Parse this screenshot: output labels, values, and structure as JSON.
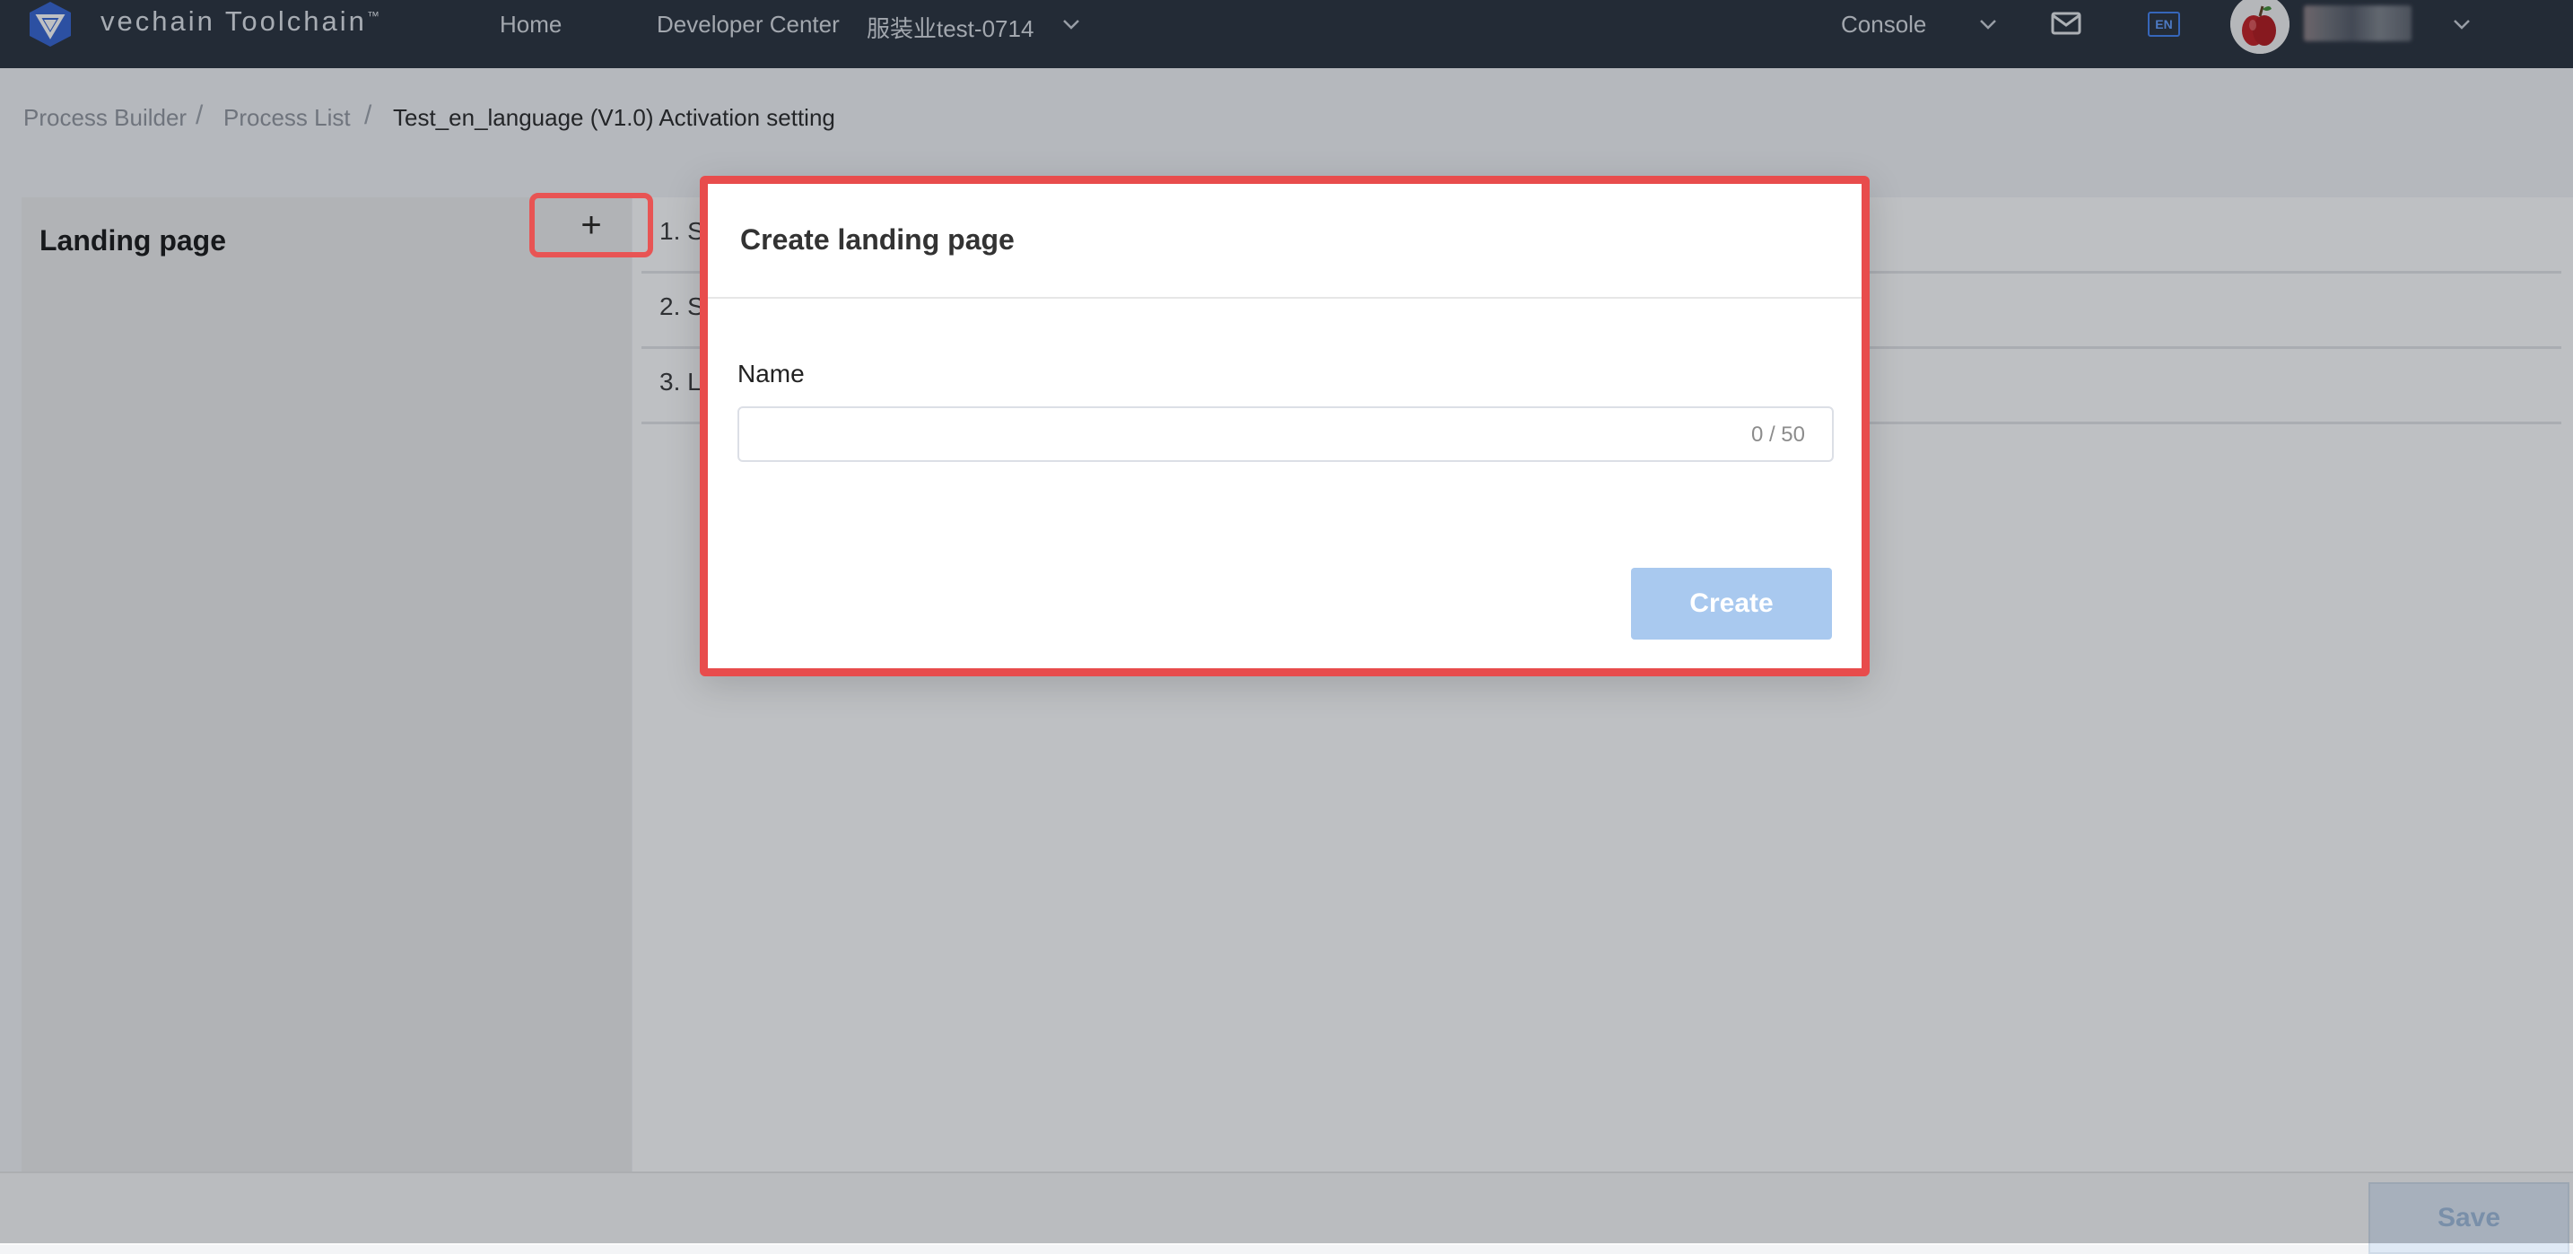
{
  "topnav": {
    "brand": "vechain Toolchain",
    "trademark": "™",
    "home": "Home",
    "developer_center": "Developer Center",
    "org": "服装业test-0714",
    "console": "Console",
    "lang_badge": "EN",
    "icons": {
      "logo": "vechain-logo-icon",
      "org_dropdown": "chevron-down-icon",
      "console_dropdown": "chevron-down-icon",
      "mail": "mail-icon",
      "language": "language-icon",
      "avatar": "avatar-apple-icon",
      "user_dropdown": "chevron-down-icon"
    }
  },
  "breadcrumb": {
    "items": [
      "Process Builder",
      "Process List",
      "Test_en_language (V1.0) Activation setting"
    ],
    "separator": "/"
  },
  "sidebar": {
    "title": "Landing page",
    "add_button": "+"
  },
  "steps": [
    "1. S",
    "2. S",
    "3. L"
  ],
  "modal": {
    "title": "Create landing page",
    "name_label": "Name",
    "name_value": "",
    "name_placeholder": "",
    "char_count": "0 / 50",
    "create_button": "Create"
  },
  "footer": {
    "save_button": "Save"
  },
  "colors": {
    "nav_bg": "#222a36",
    "highlight_red": "#e84c4c",
    "create_disabled": "#a9c9ef",
    "brand_blue": "#2f5fd0"
  }
}
